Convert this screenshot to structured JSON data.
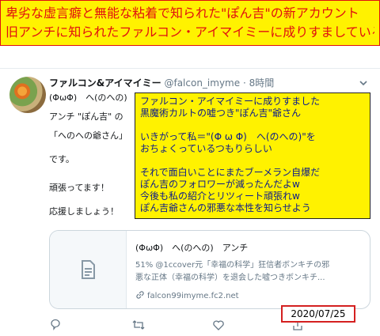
{
  "banner": {
    "line1": "卑劣な虚言癖と無能な粘着で知られた\"ぽん吉\"の新アカウント",
    "line2": "旧アンチに知られたファルコン・アイマイミーに成りすましている"
  },
  "tweet": {
    "display_name": "ファルコン&アイマイミー",
    "handle": "@falcon_imyme",
    "separator": "·",
    "time": "8時間",
    "body_lines": [
      "(ΦωΦ)　へ(のへの)",
      "アンチ \"ぽん吉\" の",
      "「へのへの爺さん」",
      "です。",
      "頑張ってます！",
      "応援しましょう！"
    ]
  },
  "overlay": {
    "lines": [
      "ファルコン・アイマイミーに成りすました",
      "黒魔術カルトの嘘つき\"ぽん吉\"爺さん",
      "",
      "いきがって私＝\"(Φ ω Φ)　へ(のへの)\"を",
      "おちょくっているつもりらしい",
      "",
      "それで面白いことにまたブーメラン自爆だ",
      "ぽん吉のフォロワーが減ったんだよw",
      "今後も私の紹介とリツィート頑張れw",
      "ぽん吉爺さんの邪悪な本性を知らせよう"
    ]
  },
  "card": {
    "title": "(ΦωΦ)　へ(のへの)　アンチ",
    "description_lines": [
      "51% @1ccover元「幸福の科学」狂信者ボンキチの邪",
      "悪な正体（幸福の科学）を退会した嘘つきボンキチ..."
    ],
    "url": "falcon99imyme.fc2.net"
  },
  "date_stamp": "2020/07/25",
  "colors": {
    "banner_bg": "#fff200",
    "banner_text": "#e01010",
    "overlay_text": "#0b1a8c",
    "secondary_text": "#657786",
    "stamp_border": "#d42020"
  },
  "icons": [
    "chevron-down-icon",
    "document-icon",
    "link-icon",
    "reply-icon",
    "retweet-icon",
    "like-icon",
    "share-icon"
  ]
}
